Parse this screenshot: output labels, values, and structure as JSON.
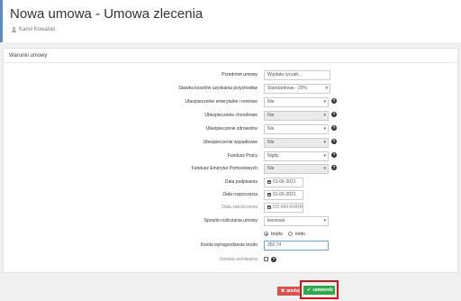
{
  "header": {
    "title": "Nowa umowa - Umowa zlecenia",
    "user": "Kamil Kowalski"
  },
  "panel": {
    "title": "Warunki umowy"
  },
  "form": {
    "przedmiot": {
      "label": "Przedmiot umowy",
      "value": "Wypłata ryczałt..."
    },
    "stawka": {
      "label": "Stawka kosztów uzyskania przychodów",
      "value": "Standardowa - 20%"
    },
    "emerytalne": {
      "label": "Ubezpieczenie emerytalne i rentowe",
      "value": "Nie"
    },
    "chorobowe": {
      "label": "Ubezpieczenie chorobowe",
      "value": "Nie"
    },
    "zdrowotne": {
      "label": "Ubezpieczenie zdrowotne",
      "value": "Nie"
    },
    "wypadkowe": {
      "label": "Ubezpieczenie wypadkowe",
      "value": "Nie"
    },
    "fundusz_pracy": {
      "label": "Fundusz Pracy",
      "value": "Nigdy"
    },
    "fundusz_emerytur": {
      "label": "Fundusz Emerytur Pomostowych",
      "value": "Nie"
    },
    "data_podpisania": {
      "label": "Data podpisania",
      "value": "01-06-2021"
    },
    "data_rozpoczecia": {
      "label": "Data rozpoczęcia",
      "value": "01-06-2021"
    },
    "data_zakonczenia": {
      "label": "Data zakończenia",
      "placeholder": "DD-MM-RRRR"
    },
    "sposob": {
      "label": "Sposób rozliczania umowy",
      "value": "kwotowo"
    },
    "brutto_label": "brutto",
    "netto_label": "netto",
    "kwota": {
      "label": "Kwota wynagrodzenia brutto",
      "value": "250,74"
    },
    "archiwalna": {
      "label": "Umowa archiwalna"
    },
    "help_glyph": "?"
  },
  "buttons": {
    "cancel": "anuluj",
    "approve": "zatwierdź"
  },
  "colors": {
    "accent": "#5a8dc7",
    "cancel": "#d9534f",
    "approve": "#2ea84a",
    "highlight": "#d0141a"
  }
}
